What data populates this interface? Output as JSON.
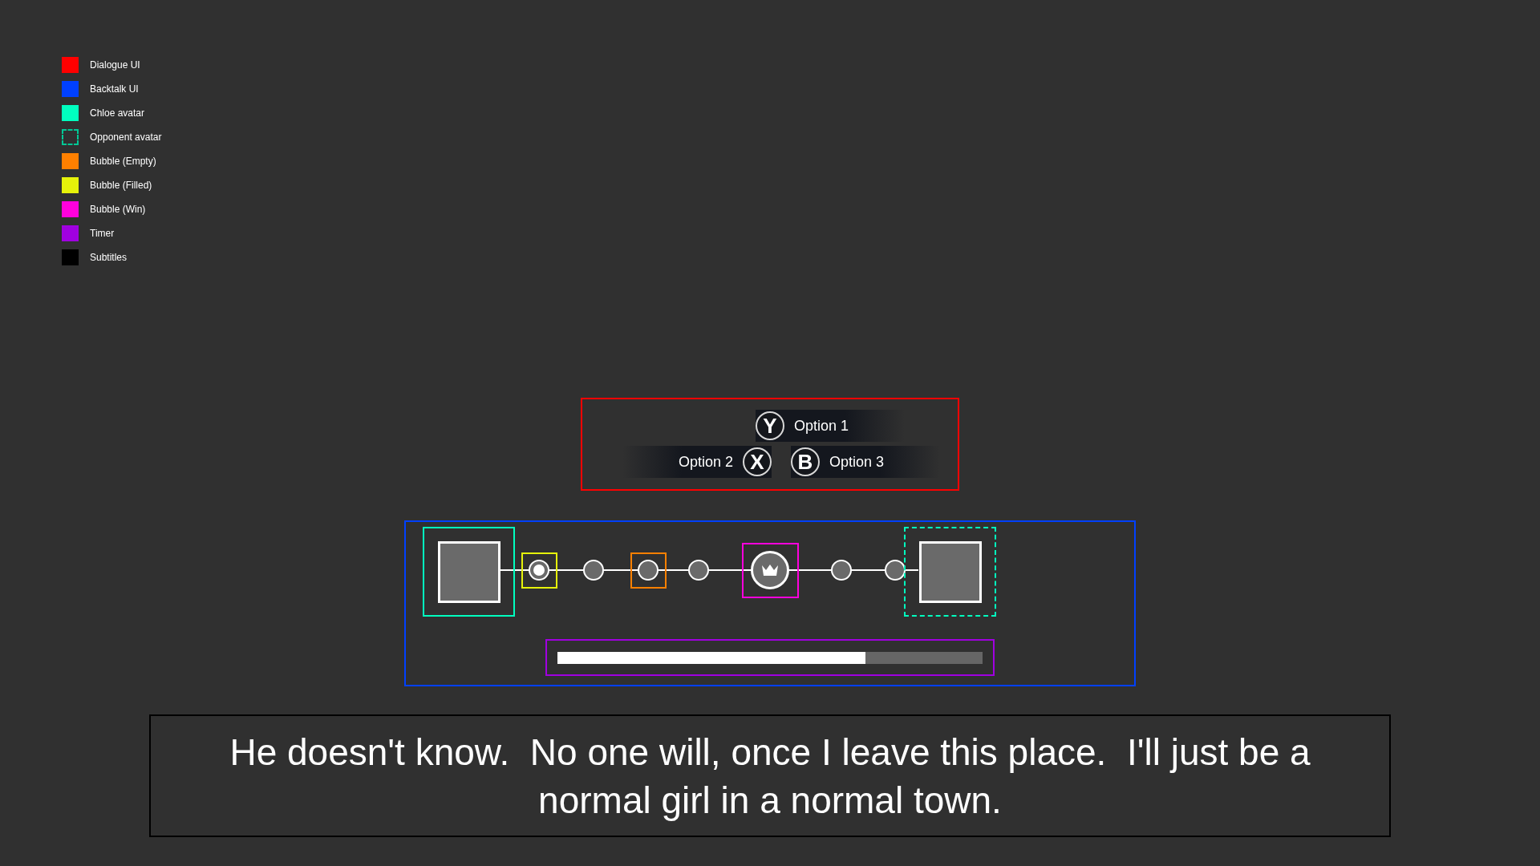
{
  "legend": [
    {
      "label": "Dialogue UI",
      "color": "#ff0000",
      "kind": "solid"
    },
    {
      "label": "Backtalk UI",
      "color": "#0040ff",
      "kind": "solid"
    },
    {
      "label": "Chloe avatar",
      "color": "#00ffbf",
      "kind": "solid"
    },
    {
      "label": "Opponent avatar",
      "color": "#00c896",
      "kind": "dashed"
    },
    {
      "label": "Bubble (Empty)",
      "color": "#ff8000",
      "kind": "solid"
    },
    {
      "label": "Bubble (Filled)",
      "color": "#e6f20a",
      "kind": "solid"
    },
    {
      "label": "Bubble (Win)",
      "color": "#ff00dd",
      "kind": "solid"
    },
    {
      "label": "Timer",
      "color": "#a000e0",
      "kind": "solid"
    },
    {
      "label": "Subtitles",
      "color": "#000000",
      "kind": "solid"
    }
  ],
  "dialogue": {
    "options": [
      {
        "button": "Y",
        "label": "Option 1"
      },
      {
        "button": "X",
        "label": "Option 2"
      },
      {
        "button": "B",
        "label": "Option 3"
      }
    ]
  },
  "backtalk": {
    "bubbles": [
      {
        "kind": "filled",
        "outlined": true
      },
      {
        "kind": "empty",
        "outlined": false
      },
      {
        "kind": "empty",
        "outlined": true
      },
      {
        "kind": "empty",
        "outlined": false
      },
      {
        "kind": "win",
        "outlined": true
      },
      {
        "kind": "empty",
        "outlined": false
      },
      {
        "kind": "empty",
        "outlined": false
      }
    ],
    "timer": {
      "level": 0.725
    }
  },
  "subtitles": {
    "text": "He doesn't know.  No one will, once I leave this place.  I'll just be a normal girl in a normal town."
  }
}
